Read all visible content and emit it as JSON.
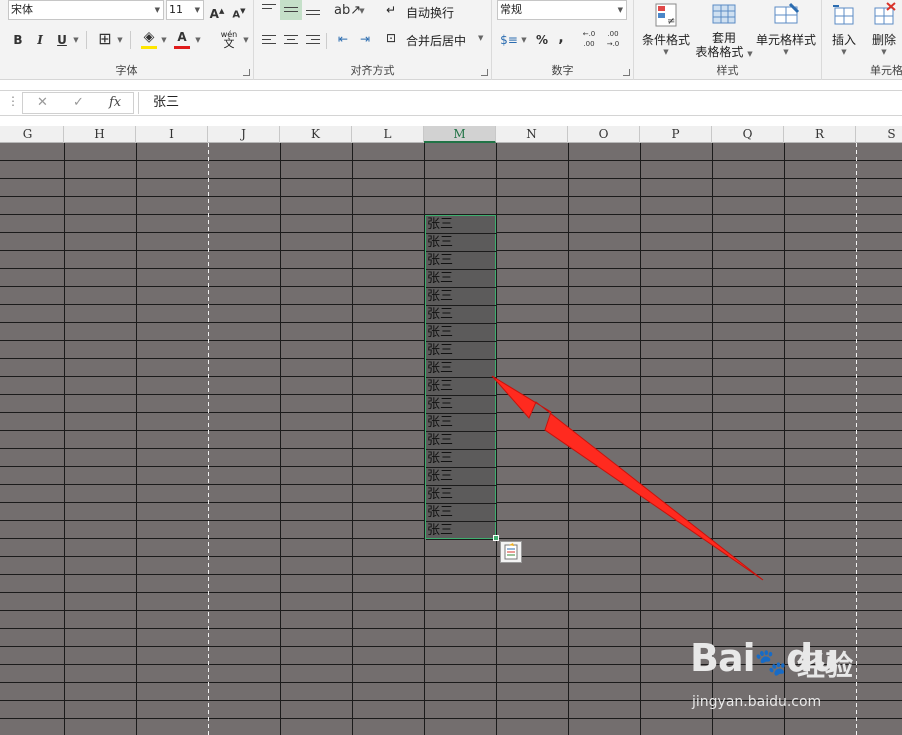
{
  "ribbon": {
    "font_group": {
      "label": "字体",
      "font_name": "宋体",
      "font_size": "11",
      "grow_font": "A",
      "shrink_font": "A",
      "bold": "B",
      "italic": "I",
      "underline": "U",
      "phonetic": "wén",
      "phonetic_char": "文"
    },
    "align_group": {
      "label": "对齐方式",
      "wrap_text": "自动换行",
      "merge_center": "合并后居中"
    },
    "number_group": {
      "label": "数字",
      "format": "常规",
      "percent": "%",
      "comma": ",",
      "inc_decimal": "←.0 .00",
      "dec_decimal": ".00 →.0"
    },
    "styles_group": {
      "label": "样式",
      "conditional": "条件格式",
      "table_format_1": "套用",
      "table_format_2": "表格格式",
      "cell_styles": "单元格样式"
    },
    "cells_group": {
      "label": "单元格",
      "insert": "插入",
      "delete": "删除"
    }
  },
  "formula_bar": {
    "cancel": "✕",
    "enter": "✓",
    "fx": "fx",
    "content": "张三"
  },
  "columns": [
    "G",
    "H",
    "I",
    "J",
    "K",
    "L",
    "M",
    "N",
    "O",
    "P",
    "Q",
    "R",
    "S"
  ],
  "selected_column": "M",
  "selected_cells": [
    "张三",
    "张三",
    "张三",
    "张三",
    "张三",
    "张三",
    "张三",
    "张三",
    "张三",
    "张三",
    "张三",
    "张三",
    "张三",
    "张三",
    "张三",
    "张三",
    "张三",
    "张三"
  ],
  "watermark": {
    "logo": "Bai",
    "logo_tail": "du",
    "brand_cn": "经验",
    "url": "jingyan.baidu.com"
  },
  "colors": {
    "sheet_bg": "#736e6e",
    "selection_border": "#3fae6f",
    "arrow": "#ff2a1f"
  }
}
